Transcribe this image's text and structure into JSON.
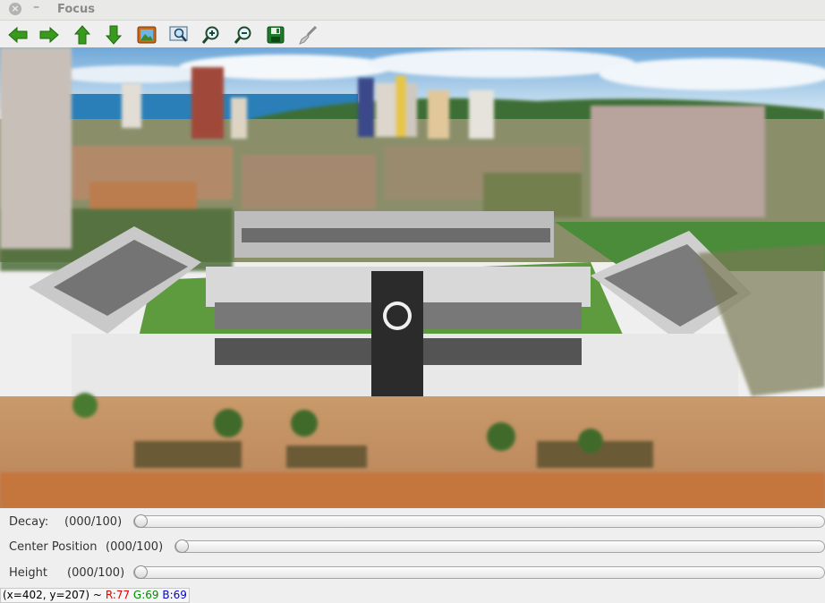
{
  "window": {
    "title": "Focus",
    "close_glyph": "×",
    "minimize_glyph": "–"
  },
  "toolbar": {
    "buttons": [
      {
        "name": "pan-left-button",
        "icon": "arrow-left-icon"
      },
      {
        "name": "pan-right-button",
        "icon": "arrow-right-icon"
      },
      {
        "name": "pan-up-button",
        "icon": "arrow-up-icon"
      },
      {
        "name": "pan-down-button",
        "icon": "arrow-down-icon"
      },
      {
        "name": "fit-image-button",
        "icon": "picture-icon"
      },
      {
        "name": "zoom-region-button",
        "icon": "zoom-region-icon"
      },
      {
        "name": "zoom-in-button",
        "icon": "zoom-in-icon"
      },
      {
        "name": "zoom-out-button",
        "icon": "zoom-out-icon"
      },
      {
        "name": "save-button",
        "icon": "save-icon"
      },
      {
        "name": "properties-button",
        "icon": "brush-icon"
      }
    ]
  },
  "trackbars": [
    {
      "label": "Decay:",
      "value_text": "(000/100)",
      "value": 0,
      "max": 100
    },
    {
      "label": "Center Position",
      "value_text": "(000/100)",
      "value": 0,
      "max": 100
    },
    {
      "label": "Height",
      "value_text": "(000/100)",
      "value": 0,
      "max": 100
    }
  ],
  "status": {
    "coords": "(x=402, y=207) ~",
    "r": "R:77",
    "g": "G:69",
    "b": "B:69",
    "colors": {
      "r": "#e00000",
      "g": "#008a00",
      "b": "#0000e0"
    }
  }
}
